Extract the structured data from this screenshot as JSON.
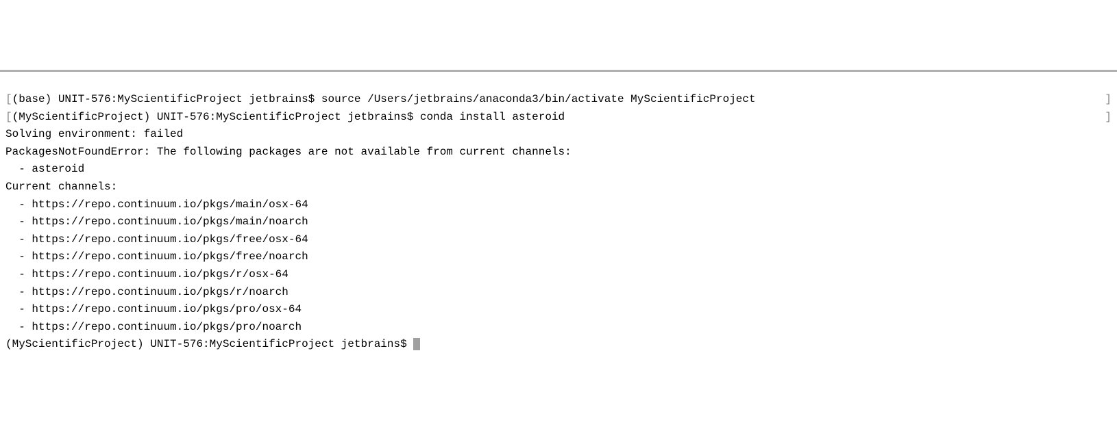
{
  "terminal": {
    "lines": {
      "l1_bracket_open": "[",
      "l1_prompt": "(base) UNIT-576:MyScientificProject jetbrains$ ",
      "l1_command": "source /Users/jetbrains/anaconda3/bin/activate MyScientificProject",
      "l1_bracket_close": "]",
      "l2_bracket_open": "[",
      "l2_prompt": "(MyScientificProject) UNIT-576:MyScientificProject jetbrains$ ",
      "l2_command": "conda install asteroid",
      "l2_bracket_close": "]",
      "l3": "Solving environment: failed",
      "l4": "",
      "l5": "PackagesNotFoundError: The following packages are not available from current channels:",
      "l6": "",
      "l7": "  - asteroid",
      "l8": "",
      "l9": "Current channels:",
      "l10": "",
      "l11": "  - https://repo.continuum.io/pkgs/main/osx-64",
      "l12": "  - https://repo.continuum.io/pkgs/main/noarch",
      "l13": "  - https://repo.continuum.io/pkgs/free/osx-64",
      "l14": "  - https://repo.continuum.io/pkgs/free/noarch",
      "l15": "  - https://repo.continuum.io/pkgs/r/osx-64",
      "l16": "  - https://repo.continuum.io/pkgs/r/noarch",
      "l17": "  - https://repo.continuum.io/pkgs/pro/osx-64",
      "l18": "  - https://repo.continuum.io/pkgs/pro/noarch",
      "l19": "",
      "l20": "",
      "l21_prompt": "(MyScientificProject) UNIT-576:MyScientificProject jetbrains$ "
    }
  }
}
